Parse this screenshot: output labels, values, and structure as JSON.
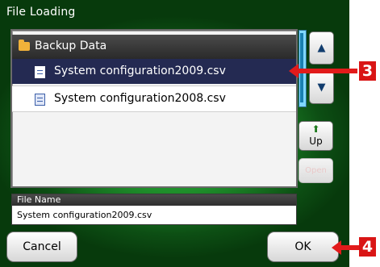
{
  "dialog": {
    "title": "File Loading"
  },
  "file_list": {
    "folder": {
      "name": "Backup Data",
      "icon": "folder-icon"
    },
    "files": [
      {
        "name": "System configuration2009.csv",
        "selected": true,
        "icon": "document-icon"
      },
      {
        "name": "System configuration2008.csv",
        "selected": false,
        "icon": "document-icon"
      }
    ]
  },
  "side_buttons": {
    "scroll_up_glyph": "▲",
    "scroll_down_glyph": "▼",
    "up_glyph": "⬆",
    "up_label": "Up",
    "open_label": "Open"
  },
  "file_name": {
    "label": "File Name",
    "value": "System configuration2009.csv"
  },
  "footer": {
    "cancel_label": "Cancel",
    "ok_label": "OK"
  },
  "callouts": [
    {
      "number": "3"
    },
    {
      "number": "4"
    }
  ],
  "colors": {
    "background_green": "#1f8f2b",
    "selected_row": "#242a52",
    "callout_red": "#e21b1b"
  }
}
